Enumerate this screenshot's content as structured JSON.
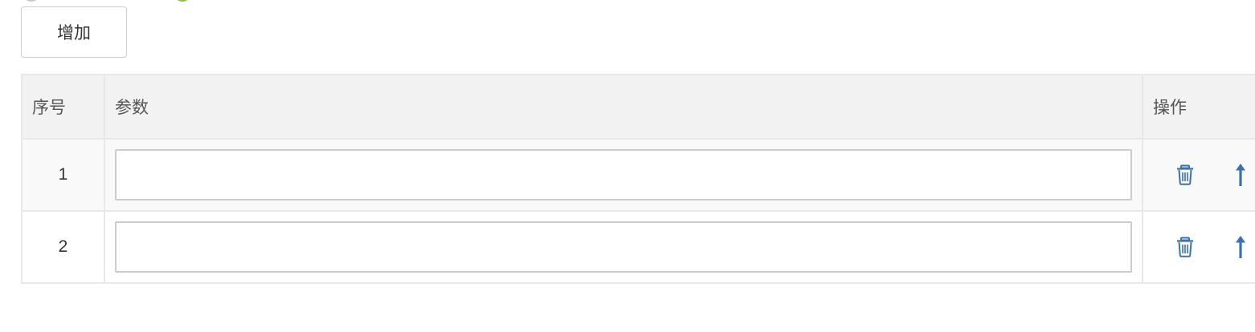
{
  "toolbar": {
    "add_label": "增加"
  },
  "table": {
    "headers": {
      "index": "序号",
      "param": "参数",
      "actions": "操作"
    },
    "rows": [
      {
        "index": "1",
        "value": ""
      },
      {
        "index": "2",
        "value": ""
      }
    ]
  },
  "icons": {
    "delete": "trash-icon",
    "move_up": "arrow-up-icon"
  },
  "colors": {
    "accent": "#3a72b0",
    "header_bg": "#f2f2f2",
    "border": "#e8e8e8",
    "radio_selected": "#8bc34a"
  }
}
